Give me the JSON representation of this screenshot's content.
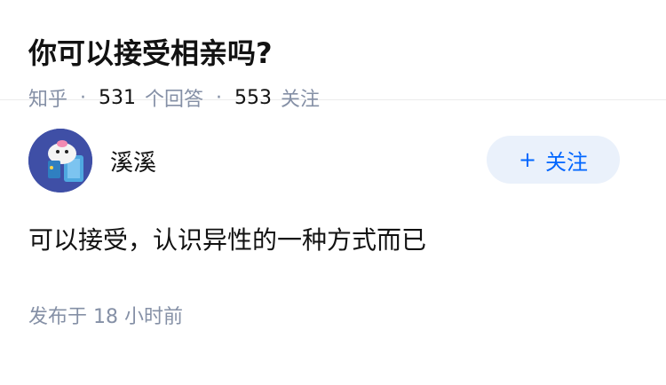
{
  "question": {
    "title": "你可以接受相亲吗?",
    "source": "知乎",
    "answers_count": "531",
    "answers_label": "个回答",
    "followers_count": "553",
    "followers_label": "关注"
  },
  "answer": {
    "author_name": "溪溪",
    "follow_label": "关注",
    "follow_icon": "plus-icon",
    "content": "可以接受，认识异性的一种方式而已",
    "published_label": "发布于",
    "published_time": "18 小时前"
  },
  "colors": {
    "accent": "#0066ff",
    "follow_bg": "#eaf1fb",
    "meta_text": "#8590a6",
    "avatar_bg": "#3f4fa6"
  }
}
